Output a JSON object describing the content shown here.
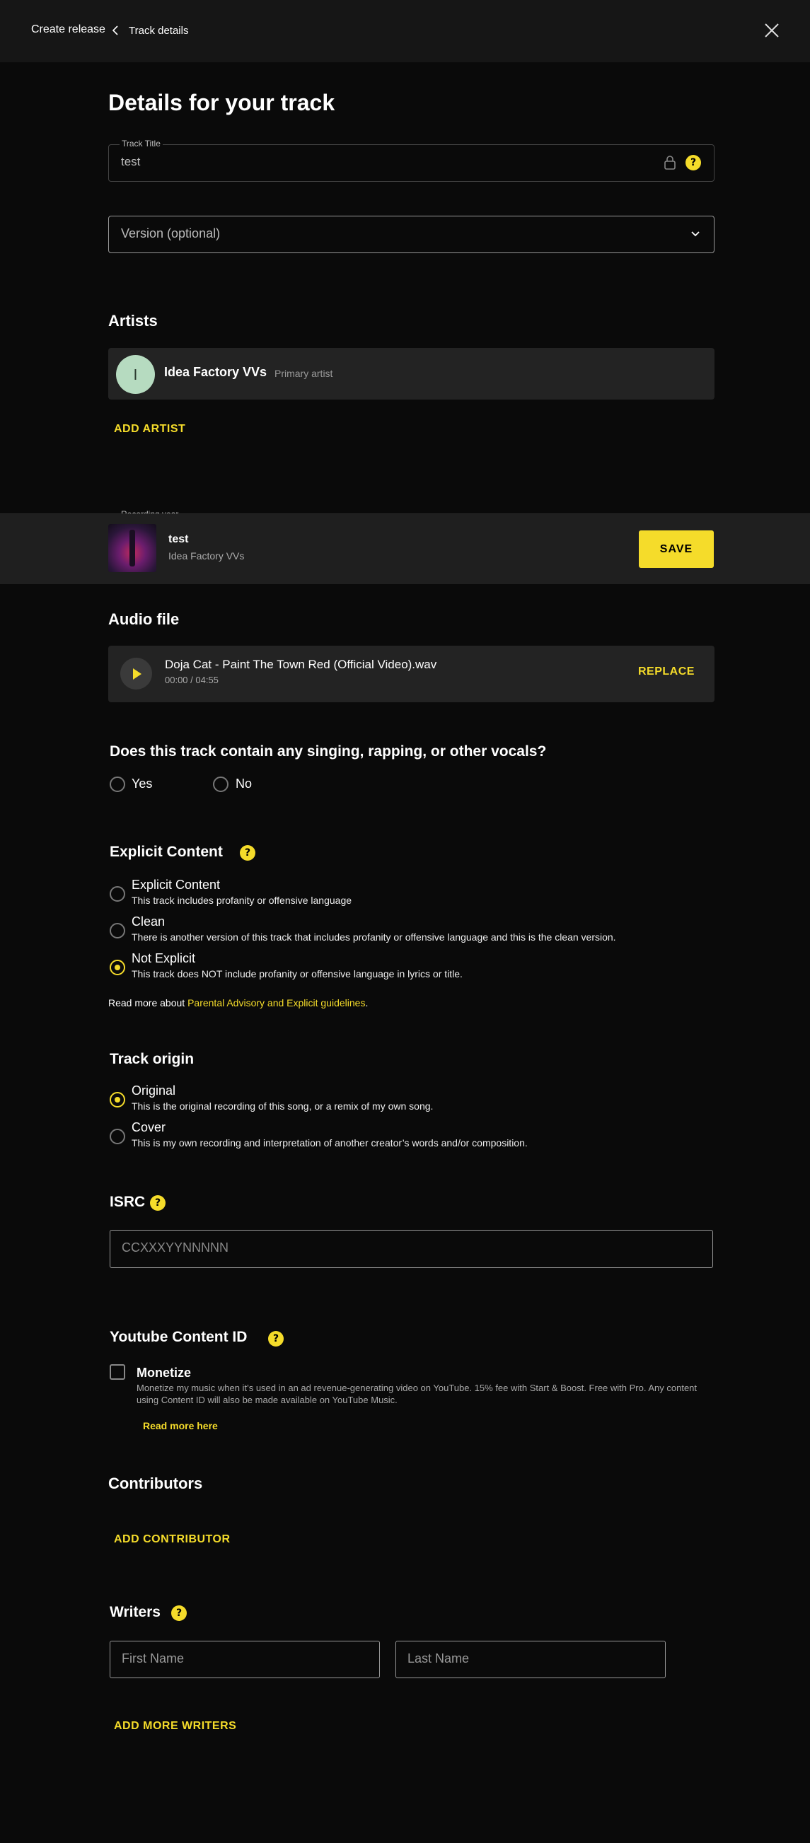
{
  "topbar": {
    "breadcrumb_root": "Create release",
    "breadcrumb_current": "Track details"
  },
  "page_title": "Details for your track",
  "track_title": {
    "label": "Track Title",
    "value": "test"
  },
  "version": {
    "placeholder": "Version (optional)"
  },
  "artists": {
    "heading": "Artists",
    "items": [
      {
        "initial": "I",
        "name": "Idea Factory VVs",
        "role": "Primary artist",
        "avatar_color": "#b6dbc0"
      }
    ],
    "add_label": "ADD ARTIST"
  },
  "recording_year_label": "Recording year",
  "sticky_bar": {
    "title": "test",
    "artist": "Idea Factory VVs",
    "save_label": "SAVE"
  },
  "audio": {
    "heading": "Audio file",
    "filename": "Doja Cat - Paint The Town Red (Official Video).wav",
    "time": "00:00 / 04:55",
    "replace_label": "REPLACE"
  },
  "vocals": {
    "question": "Does this track contain any singing, rapping, or other vocals?",
    "options": [
      "Yes",
      "No"
    ],
    "selected": null
  },
  "explicit": {
    "heading": "Explicit Content",
    "options": [
      {
        "label": "Explicit Content",
        "desc": "This track includes profanity or offensive language"
      },
      {
        "label": "Clean",
        "desc": "There is another version of this track that includes profanity or offensive language and this is the clean version."
      },
      {
        "label": "Not Explicit",
        "desc": "This track does NOT include profanity or offensive language in lyrics or title."
      }
    ],
    "selected": "Not Explicit",
    "read_more_prefix": "Read more about ",
    "read_more_link": "Parental Advisory and Explicit guidelines",
    "read_more_suffix": "."
  },
  "origin": {
    "heading": "Track origin",
    "options": [
      {
        "label": "Original",
        "desc": "This is the original recording of this song, or a remix of my own song."
      },
      {
        "label": "Cover",
        "desc": "This is my own recording and interpretation of another creator’s words and/or composition."
      }
    ],
    "selected": "Original"
  },
  "isrc": {
    "heading": "ISRC",
    "placeholder": "CCXXXYYNNNNN"
  },
  "content_id": {
    "heading": "Youtube Content ID",
    "monetize_label": "Monetize",
    "monetize_desc": "Monetize my music when it’s used in an ad revenue-generating video on YouTube. 15% fee with Start & Boost. Free with Pro. Any content using Content ID will also be made available on YouTube Music.",
    "checked": false,
    "read_more": "Read more here"
  },
  "contributors": {
    "heading": "Contributors",
    "add_label": "ADD CONTRIBUTOR"
  },
  "writers": {
    "heading": "Writers",
    "first_name_placeholder": "First Name",
    "last_name_placeholder": "Last Name",
    "add_label": "ADD MORE WRITERS"
  },
  "colors": {
    "accent": "#f5dc2a",
    "background": "#0a0a0a",
    "card": "#232323"
  }
}
